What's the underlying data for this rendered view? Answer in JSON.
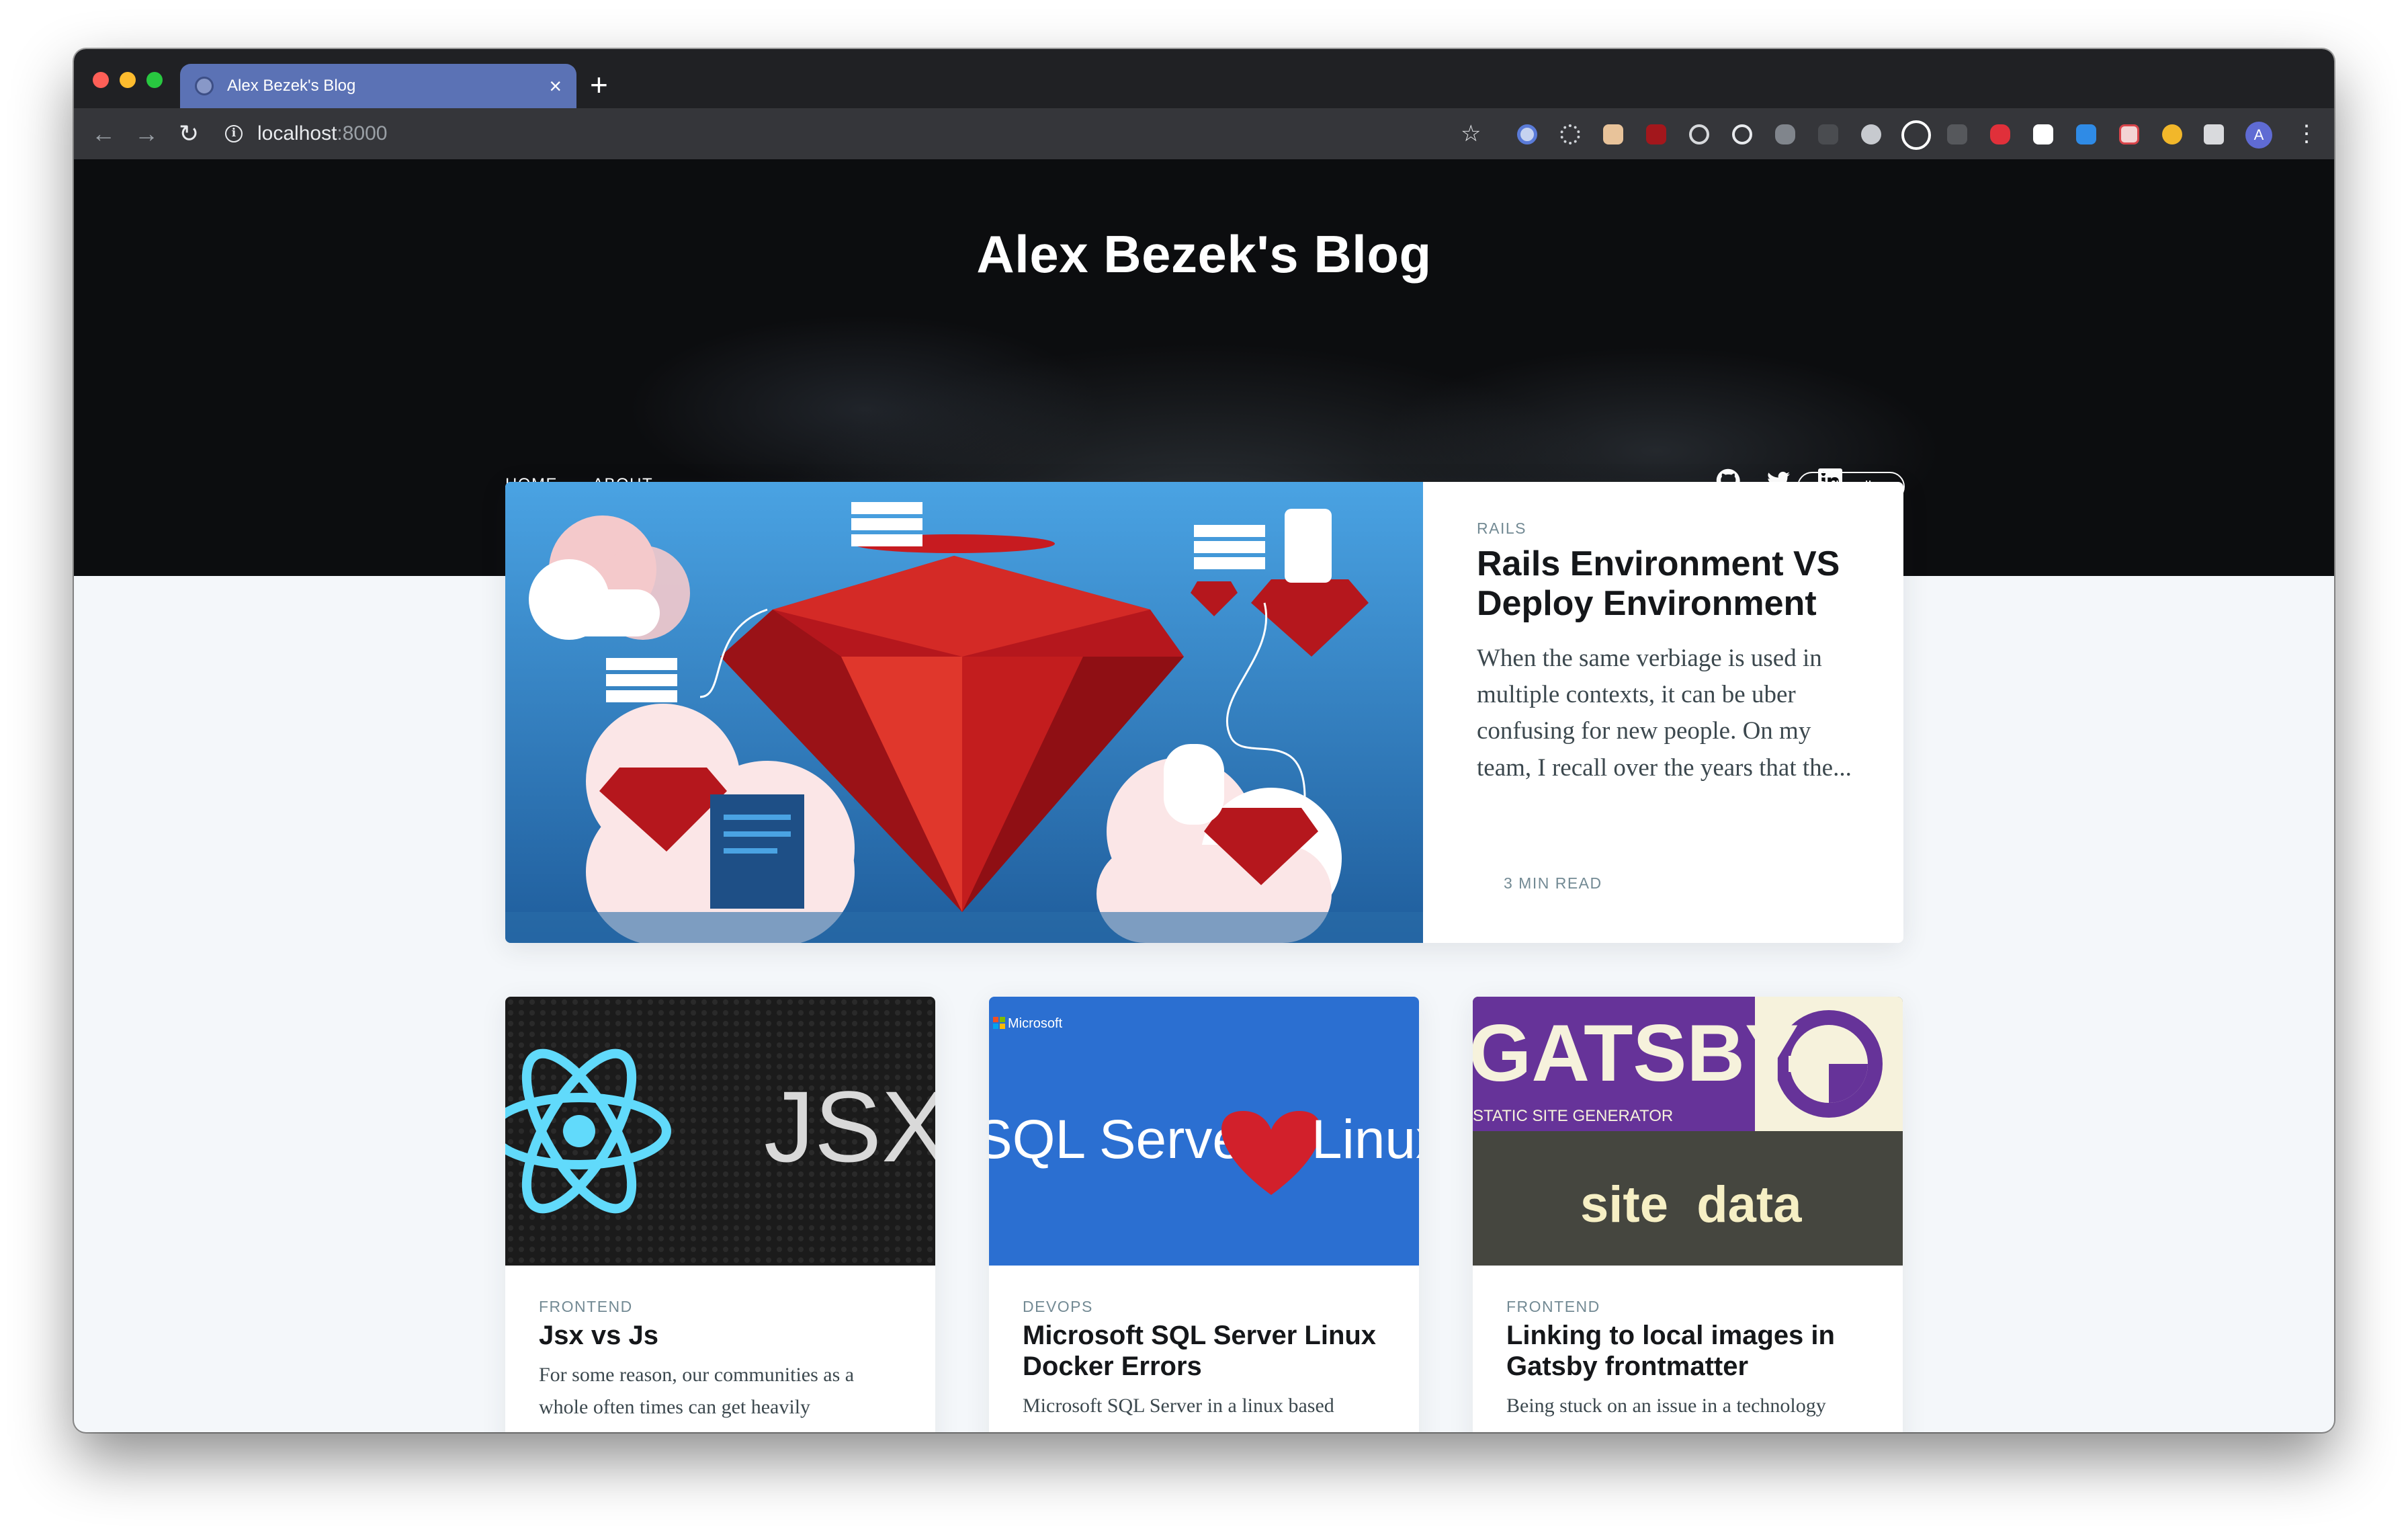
{
  "browser": {
    "tab_title": "Alex Bezek's Blog",
    "tab_close": "×",
    "new_tab": "+",
    "address_host": "localhost",
    "address_port": ":8000",
    "avatar_letter": "A",
    "back_glyph": "←",
    "forward_glyph": "→",
    "reload_glyph": "↻",
    "star_glyph": "☆",
    "menu_glyph": "⋮",
    "info_glyph": "i"
  },
  "site": {
    "title": "Alex Bezek's Blog",
    "nav": [
      "HOME",
      "ABOUT"
    ],
    "subscribe_label": "Subscribe",
    "social_icons": [
      "github-icon",
      "twitter-icon",
      "linkedin-icon"
    ]
  },
  "featured": {
    "tag": "RAILS",
    "title": "Rails Environment VS Deploy Environment",
    "excerpt": "When the same verbiage is used in multiple contexts, it can be uber confusing for new people. On my team, I recall over the years that the...",
    "read_time": "3 MIN READ"
  },
  "posts": [
    {
      "tag": "FRONTEND",
      "title": "Jsx vs Js",
      "excerpt": "For some reason, our communities as a whole often times can get heavily",
      "image_text": "JSX"
    },
    {
      "tag": "DEVOPS",
      "title": "Microsoft SQL Server Linux Docker Errors",
      "excerpt": "Microsoft SQL Server in a linux based",
      "image_brand": "Microsoft",
      "image_left": "SQL Server",
      "image_right": "Linux"
    },
    {
      "tag": "FRONTEND",
      "title": "Linking to local images in Gatsby frontmatter",
      "excerpt": "Being stuck on an issue in a technology",
      "image_title": "GATSBY",
      "image_subtitle": "STATIC SITE GENERATOR",
      "image_bottom": "site  data"
    }
  ],
  "colors": {
    "tab_active": "#5b72b5",
    "hero_bg": "#0c0d0f",
    "page_bg": "#f4f7fa",
    "ruby": "#c4161c",
    "sql_blue": "#2b6fd1",
    "gatsby_purple": "#663399"
  }
}
